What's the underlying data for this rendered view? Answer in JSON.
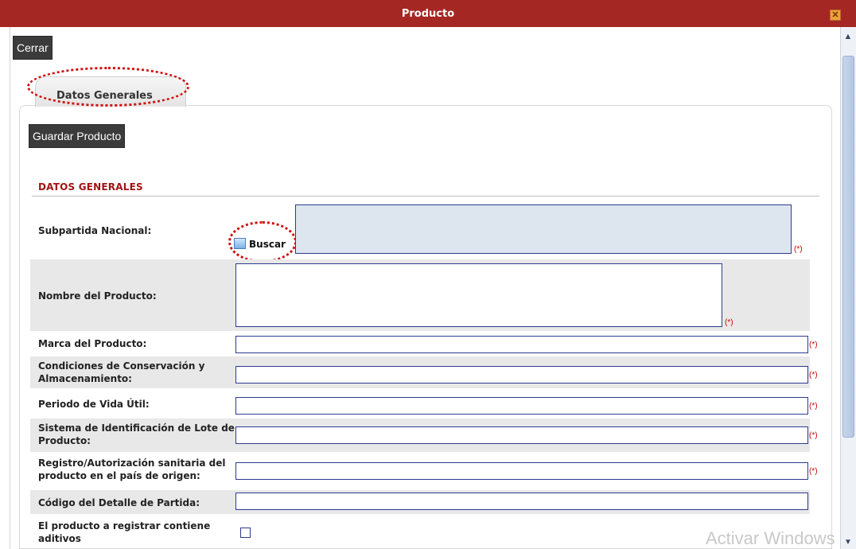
{
  "window": {
    "title": "Producto",
    "close_glyph": "✕"
  },
  "toolbar": {
    "close_label": "Cerrar"
  },
  "tabs": [
    {
      "label": "Datos Generales"
    }
  ],
  "panel": {
    "save_label": "Guardar Producto",
    "section_title": "DATOS GENERALES"
  },
  "fields": {
    "subpartida": {
      "label": "Subpartida Nacional:",
      "search_label": "Buscar",
      "value": "",
      "required": "(*)"
    },
    "nombre": {
      "label": "Nombre del Producto:",
      "value": "",
      "required": "(*)"
    },
    "marca": {
      "label": "Marca del Producto:",
      "value": "",
      "required": "(*)"
    },
    "condiciones": {
      "label": "Condiciones de Conservación y Almacenamiento:",
      "value": "",
      "required": "(*)"
    },
    "periodo": {
      "label": "Periodo de Vida Útil:",
      "value": "",
      "required": "(*)"
    },
    "sistema": {
      "label": "Sistema de Identificación de Lote de Producto:",
      "value": "",
      "required": "(*)"
    },
    "registro": {
      "label": "Registro/Autorización sanitaria del producto en el país de origen:",
      "value": "",
      "required": "(*)"
    },
    "codigo": {
      "label": "Código del Detalle de Partida:",
      "value": ""
    },
    "aditivos": {
      "label": "El producto a registrar contiene aditivos",
      "checked": false
    }
  },
  "scrollbar": {
    "up_glyph": "▲",
    "down_glyph": "▼"
  },
  "watermark": {
    "text": "Activar Windows"
  },
  "colors": {
    "titlebar": "#a52723",
    "section_title": "#a01414",
    "input_border": "#2e3a91",
    "highlight": "#d10f0f"
  },
  "icons": {
    "search": "search-icon",
    "close": "close-icon"
  }
}
